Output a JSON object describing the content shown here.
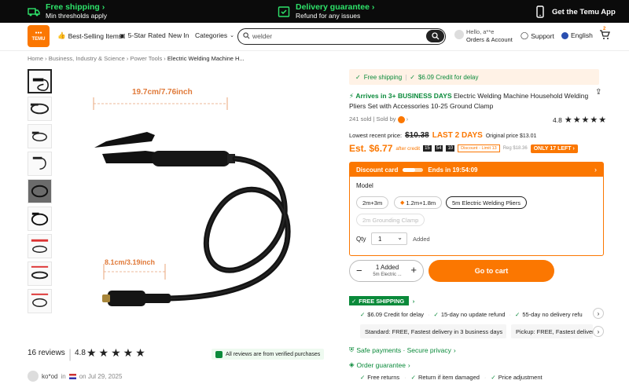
{
  "colors": {
    "brand": "#fb7701",
    "green": "#0a8a3a",
    "topbar_bg": "#0b0b0b",
    "promo_green": "#2ee36a"
  },
  "topbar": {
    "free_shipping_title": "Free shipping",
    "free_shipping_sub": "Min thresholds apply",
    "delivery_title": "Delivery guarantee",
    "delivery_sub": "Refund for any issues",
    "app_label": "Get the Temu App"
  },
  "header": {
    "logo_text": "TEMU",
    "nav": [
      "Best-Selling Items",
      "5-Star Rated",
      "New In",
      "Categories"
    ],
    "search_value": "welder",
    "account_greeting": "Hello, a**e",
    "account_label": "Orders & Account",
    "support": "Support",
    "language": "English",
    "cart_count": "2"
  },
  "breadcrumb": [
    "Home",
    "Business, Industry & Science",
    "Power Tools",
    "Electric Welding Machine H..."
  ],
  "gallery": {
    "dim_top": "19.7cm/7.76inch",
    "dim_bottom": "8.1cm/3.19inch",
    "thumb_count": 9
  },
  "reviews": {
    "count_label": "16 reviews",
    "rating": "4.8",
    "verified": "All reviews are from verified purchases",
    "reviewer_name": "ko*od",
    "reviewer_date": "on Jul 29, 2025"
  },
  "product": {
    "ship_bar_1": "Free shipping",
    "ship_bar_2": "$6.09 Credit for delay",
    "arrives": "Arrives in 3+ BUSINESS DAYS",
    "title": "Electric Welding Machine Household Welding Pliers Set with Accessories 10-25 Ground Clamp",
    "sold": "241 sold",
    "sold_by": "Sold by",
    "rating": "4.8",
    "lowest_label": "Lowest recent price:",
    "lowest_price": "$10.38",
    "last_days": "LAST 2 DAYS",
    "original_price": "Original price $13.01",
    "est_price": "Est. $6.77",
    "after_credit": "after credit",
    "timer": [
      "15",
      "54",
      "10"
    ],
    "discount_badge": "Discount - Limit 13",
    "reg_price": "Reg $18.36",
    "only_left": "ONLY 17 LEFT"
  },
  "discount_card": {
    "label": "Discount card",
    "ends": "Ends in  19:54:09",
    "model_label": "Model",
    "models": [
      "2m+3m",
      "1.2m+1.8m",
      "5m Electric Welding Pliers",
      "2m Grounding Clamp"
    ],
    "selected_model": 2,
    "qty_label": "Qty",
    "qty_value": "1",
    "added": "Added"
  },
  "cart": {
    "added_count": "1 Added",
    "added_item": "5m Electric ...",
    "button": "Go to cart"
  },
  "shipping": {
    "badge": "FREE SHIPPING",
    "perks": [
      "$6.09 Credit for delay",
      "15-day no update refund",
      "55-day no delivery refu"
    ],
    "standard": "Standard: FREE, Fastest delivery in 3 business days",
    "pickup": "Pickup: FREE, Fastest deliver"
  },
  "safety": {
    "safe_payments": "Safe payments · Secure privacy",
    "order_guarantee": "Order guarantee",
    "guarantees": [
      "Free returns",
      "Return if item damaged",
      "Price adjustment"
    ]
  }
}
